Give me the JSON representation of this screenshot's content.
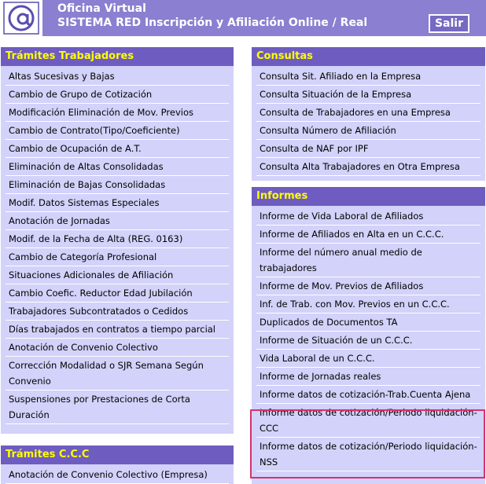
{
  "header": {
    "title_line1": "Oficina Virtual",
    "title_line2": "SISTEMA RED Inscripción y Afiliación Online / Real",
    "logout_label": "Salir",
    "logo_icon": "at-sign-logo-icon"
  },
  "colors": {
    "header_bg": "#8a7fd0",
    "panel_head_bg": "#6e5cc0",
    "panel_head_text": "#ffff00",
    "panel_bg": "#d2d2fa",
    "highlight_border": "#d6336c"
  },
  "tramites_trabajadores": {
    "title": "Trámites Trabajadores",
    "items": [
      "Altas Sucesivas y Bajas",
      "Cambio de Grupo de Cotización",
      "Modificación Eliminación de Mov. Previos",
      "Cambio de Contrato(Tipo/Coeficiente)",
      "Cambio de Ocupación de A.T.",
      "Eliminación de Altas Consolidadas",
      "Eliminación de Bajas Consolidadas",
      "Modif. Datos Sistemas Especiales",
      "Anotación de Jornadas",
      "Modif. de la Fecha de Alta (REG. 0163)",
      "Cambio de Categoría Profesional",
      "Situaciones Adicionales de Afiliación",
      "Cambio Coefic. Reductor Edad Jubilación",
      "Trabajadores Subcontratados o Cedidos",
      "Días trabajados en contratos a tiempo parcial",
      "Anotación de Convenio Colectivo",
      "Corrección Modalidad o SJR Semana Según Convenio",
      "Suspensiones por Prestaciones de Corta Duración"
    ]
  },
  "consultas": {
    "title": "Consultas",
    "items": [
      "Consulta Sit. Afiliado en la Empresa",
      "Consulta Situación de la Empresa",
      "Consulta de Trabajadores en una Empresa",
      "Consulta Número de Afiliación",
      "Consulta de NAF por IPF",
      "Consulta Alta Trabajadores en Otra Empresa"
    ]
  },
  "informes": {
    "title": "Informes",
    "items": [
      "Informe de Vida Laboral de Afiliados",
      "Informe de Afiliados en Alta en un C.C.C.",
      "Informe del número anual medio de trabajadores",
      "Informe de Mov. Previos de Afiliados",
      "Inf. de Trab. con Mov. Previos en un C.C.C.",
      "Duplicados de Documentos TA",
      "Informe de Situación de un C.C.C.",
      "Vida Laboral de un C.C.C.",
      "Informe de Jornadas reales",
      "Informe datos de cotización-Trab.Cuenta Ajena",
      "Informe datos de cotización/Periodo liquidación-CCC",
      "Informe datos de cotización/Periodo liquidación-NSS"
    ]
  },
  "tramites_ccc": {
    "title": "Trámites C.C.C",
    "items": [
      "Anotación de Convenio Colectivo (Empresa)"
    ]
  }
}
